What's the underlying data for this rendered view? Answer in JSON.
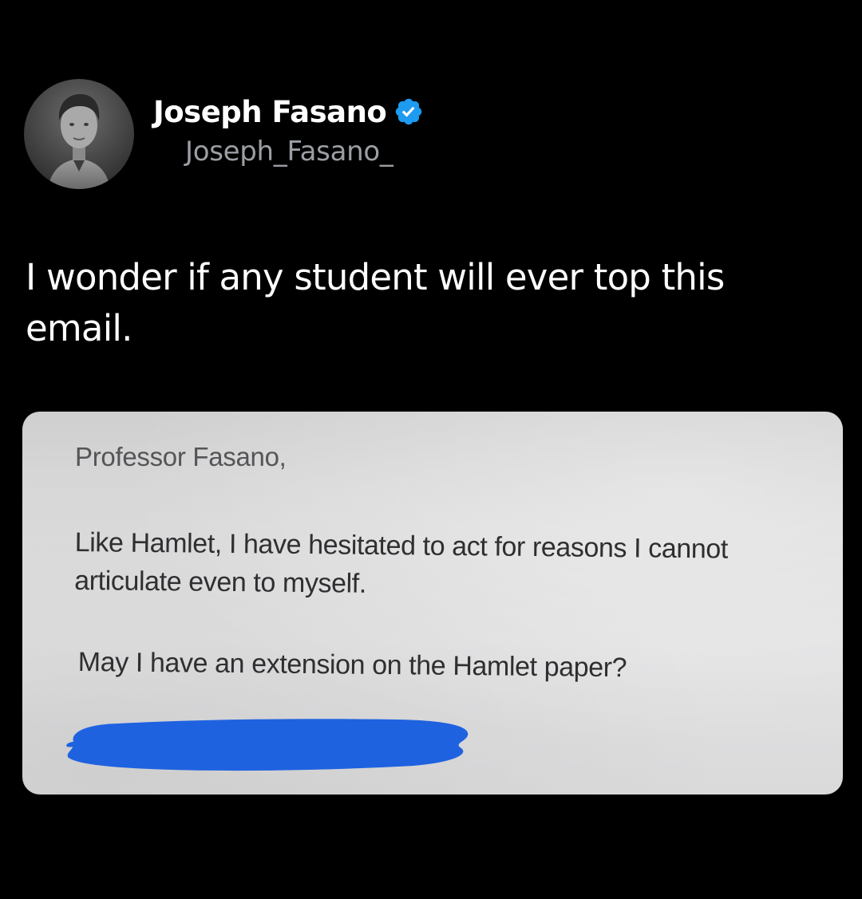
{
  "tweet": {
    "author": {
      "display_name": "Joseph Fasano",
      "handle": "Joseph_Fasano_",
      "verified": true,
      "verified_icon": "verified-badge-icon",
      "avatar_icon": "profile-photo"
    },
    "text": "I wonder if any student will ever top this email.",
    "media": {
      "email": {
        "greeting": "Professor Fasano,",
        "paragraph_1": "Like Hamlet, I have hesitated to act for reasons I cannot articulate even to myself.",
        "paragraph_2": "May I have an extension on the Hamlet paper?",
        "signature": "redacted"
      }
    }
  },
  "colors": {
    "background": "#000000",
    "text_primary": "#ffffff",
    "text_secondary": "#9b9fa4",
    "verified_blue": "#1d9bf0",
    "redaction_blue": "#1f62e0"
  }
}
